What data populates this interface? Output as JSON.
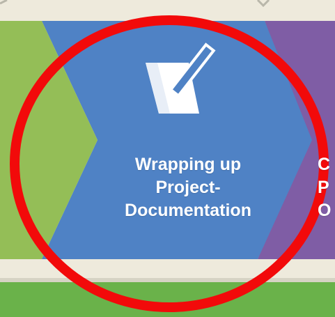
{
  "colors": {
    "background": "#eeeadc",
    "step_green": "#94be57",
    "step_blue": "#4f82c5",
    "step_purple": "#7f5da5",
    "footer_green": "#6ab24a",
    "highlight_circle": "#f20a0a"
  },
  "steps": [
    {
      "color": "step_green",
      "lines": []
    },
    {
      "icon": "document-pen-icon",
      "color": "step_blue",
      "lines": [
        "Wrapping up",
        "Project-",
        "Documentation"
      ]
    },
    {
      "color": "step_purple",
      "lines": [
        "C",
        "P",
        "O"
      ]
    }
  ],
  "annotation": {
    "shape": "circle",
    "color": "highlight_circle"
  }
}
